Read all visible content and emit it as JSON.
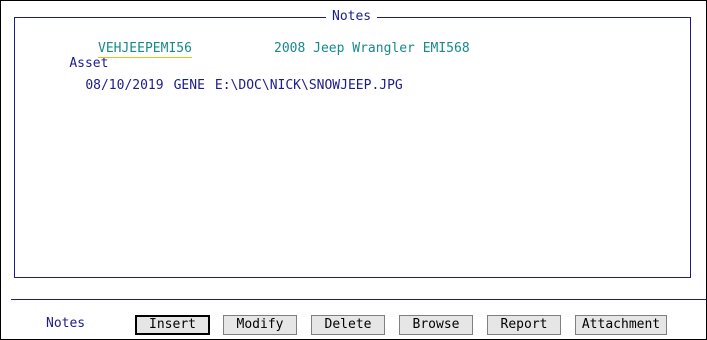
{
  "panel": {
    "title": "Notes",
    "asset_label": "Asset",
    "asset_id": "VEHJEEPEMI56",
    "asset_description": "2008 Jeep Wrangler EMI568"
  },
  "note": {
    "date": "08/10/2019",
    "user": "GENE",
    "path": "E:\\DOC\\NICK\\SNOWJEEP.JPG"
  },
  "footer": {
    "label": "Notes",
    "buttons": {
      "insert": "Insert",
      "modify": "Modify",
      "delete": "Delete",
      "browse": "Browse",
      "report": "Report",
      "attachment": "Attachment"
    }
  },
  "colors": {
    "label": "#1c1c8c",
    "value": "#178a8a",
    "focus_underline": "#e6c21a"
  }
}
